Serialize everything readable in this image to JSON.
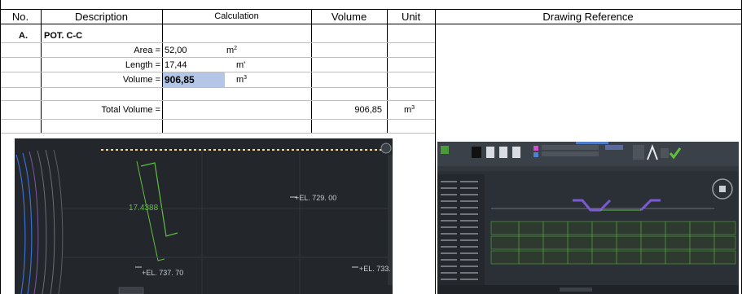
{
  "header": {
    "no": "No.",
    "description": "Description",
    "calculation": "Calculation",
    "volume": "Volume",
    "unit": "Unit",
    "drawing_reference": "Drawing Reference"
  },
  "section": {
    "no": "A.",
    "title": "POT. C-C"
  },
  "rows": {
    "area_label": "Area =",
    "area_value": "52,00",
    "area_unit": "m",
    "area_unit_exp": "2",
    "length_label": "Length =",
    "length_value": "17,44",
    "length_unit": "m'",
    "volume_label": "Volume =",
    "volume_value": "906,85",
    "volume_unit": "m",
    "volume_unit_exp": "3",
    "total_label": "Total Volume =",
    "total_value": "906,85",
    "total_unit": "m",
    "total_unit_exp": "3"
  },
  "colors": {
    "highlight": "#b4c6e7",
    "cad_bg": "#23272c",
    "cad_green": "#5fbf3f",
    "cad_dash": "#f2d9a8"
  },
  "cad_left": {
    "dimension_text": "17.4388",
    "el_1": "+EL. 729. 00",
    "el_2": "+EL. 737. 70",
    "el_3": "+EL. 733."
  }
}
